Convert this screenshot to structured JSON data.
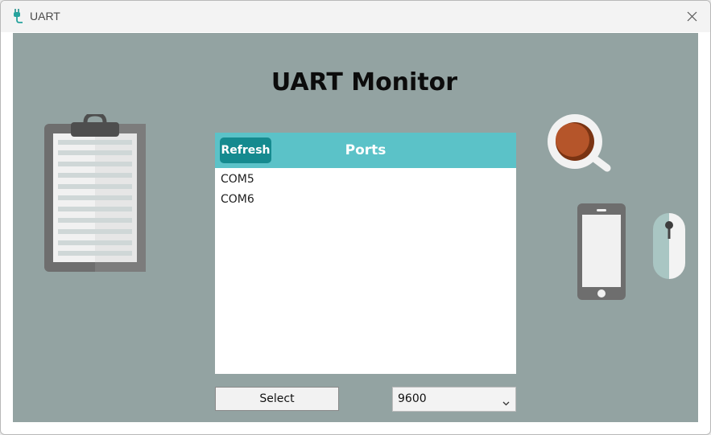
{
  "window": {
    "title": "UART",
    "icon": "usb-plug-icon",
    "close_icon": "close-icon"
  },
  "app": {
    "heading": "UART Monitor"
  },
  "ports": {
    "refresh_label": "Refresh",
    "header_label": "Ports",
    "items": [
      {
        "label": "COM5"
      },
      {
        "label": "COM6"
      }
    ]
  },
  "controls": {
    "select_label": "Select",
    "baud_value": "9600",
    "baud_icon": "chevron-down-icon"
  },
  "decorations": [
    "clipboard-icon",
    "coffee-cup-icon",
    "smartphone-icon",
    "computer-mouse-icon"
  ],
  "colors": {
    "background": "#93a3a2",
    "header": "#5bc2c8",
    "refresh_button": "#158a8f"
  }
}
